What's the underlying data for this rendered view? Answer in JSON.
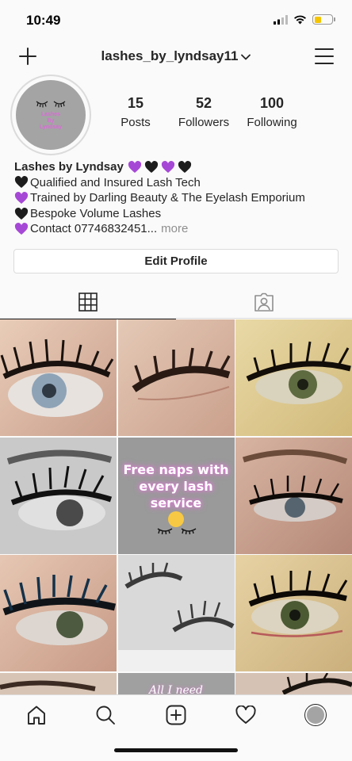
{
  "status": {
    "time": "10:49"
  },
  "header": {
    "username": "lashes_by_lyndsay11"
  },
  "avatar": {
    "logo_lines": [
      "Lashes",
      "By",
      "Lyndsay"
    ]
  },
  "stats": [
    {
      "value": "15",
      "label": "Posts"
    },
    {
      "value": "52",
      "label": "Followers"
    },
    {
      "value": "100",
      "label": "Following"
    }
  ],
  "bio": {
    "name": "Lashes by Lyndsay",
    "name_hearts": [
      "purple",
      "black",
      "purple",
      "black"
    ],
    "lines": [
      {
        "heart": "black",
        "text": "Qualified and Insured Lash Tech"
      },
      {
        "heart": "purple",
        "text": "Trained by Darling Beauty & The Eyelash Emporium"
      },
      {
        "heart": "black",
        "text": "Bespoke Volume Lashes"
      },
      {
        "heart": "purple",
        "text": "Contact 07746832451..."
      }
    ],
    "more_label": "more"
  },
  "edit_profile_label": "Edit Profile",
  "colors": {
    "purple_heart": "#a648d6",
    "black_heart": "#1c1c1c",
    "promo_glow": "#e07ad8"
  },
  "posts": {
    "promo": {
      "lines": [
        "Free naps with",
        "every lash",
        "service"
      ]
    },
    "promo2": {
      "text": "All I need"
    }
  },
  "bottom_nav": [
    "home-icon",
    "search-icon",
    "new-post-icon",
    "activity-heart-icon",
    "profile-avatar"
  ]
}
